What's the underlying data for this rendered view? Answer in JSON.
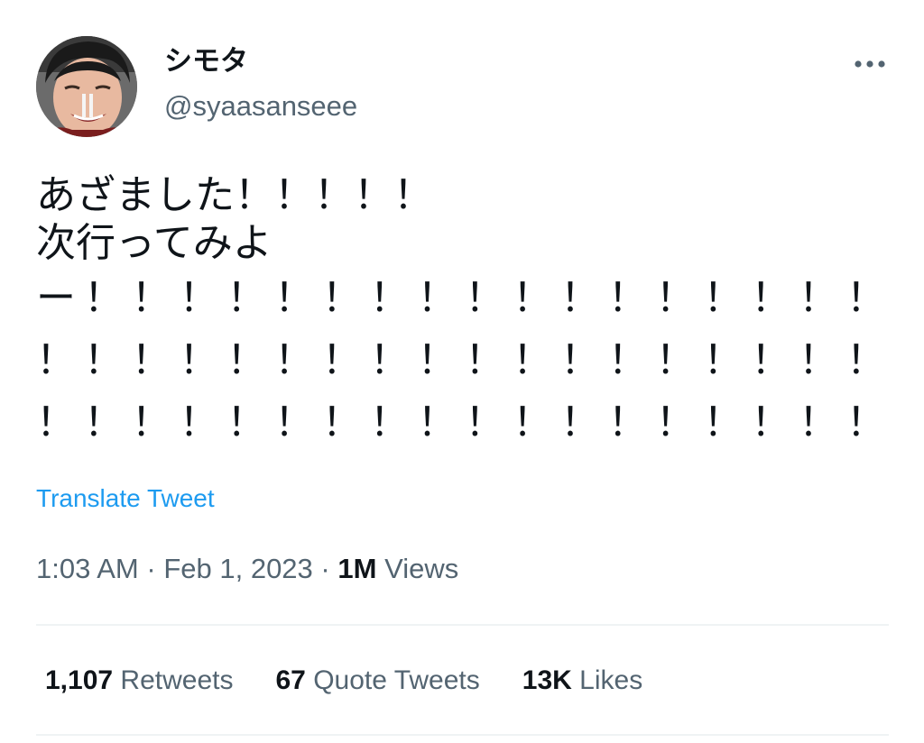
{
  "author": {
    "display_name": "シモタ",
    "handle": "@syaasanseee"
  },
  "icons": {
    "avatar": "profile-photo",
    "more": "more-horizontal-icon"
  },
  "tweet": {
    "lines": [
      "あざました！！！！！",
      "次行ってみよ",
      "ー"
    ],
    "bang_rows": [
      [
        "！",
        "！",
        "！",
        "！",
        "！",
        "！",
        "！",
        "！",
        "！",
        "！",
        "！",
        "！",
        "！",
        "！",
        "！",
        "！",
        "！"
      ],
      [
        "！",
        "！",
        "！",
        "！",
        "！",
        "！",
        "！",
        "！",
        "！",
        "！",
        "！",
        "！",
        "！",
        "！",
        "！",
        "！",
        "！",
        "！"
      ],
      [
        "！",
        "！",
        "！",
        "！",
        "！",
        "！",
        "！",
        "！",
        "！",
        "！",
        "！",
        "！",
        "！",
        "！",
        "！",
        "！",
        "！",
        "！"
      ]
    ],
    "translate_label": "Translate Tweet"
  },
  "meta": {
    "time": "1:03 AM",
    "separator": "·",
    "date": "Feb 1, 2023",
    "views_count": "1M",
    "views_label": "Views"
  },
  "stats": {
    "retweets_count": "1,107",
    "retweets_label": "Retweets",
    "quotes_count": "67",
    "quotes_label": "Quote Tweets",
    "likes_count": "13K",
    "likes_label": "Likes"
  },
  "colors": {
    "text": "#0f1419",
    "secondary": "#536471",
    "link": "#1d9bf0",
    "divider": "#eff3f4"
  }
}
